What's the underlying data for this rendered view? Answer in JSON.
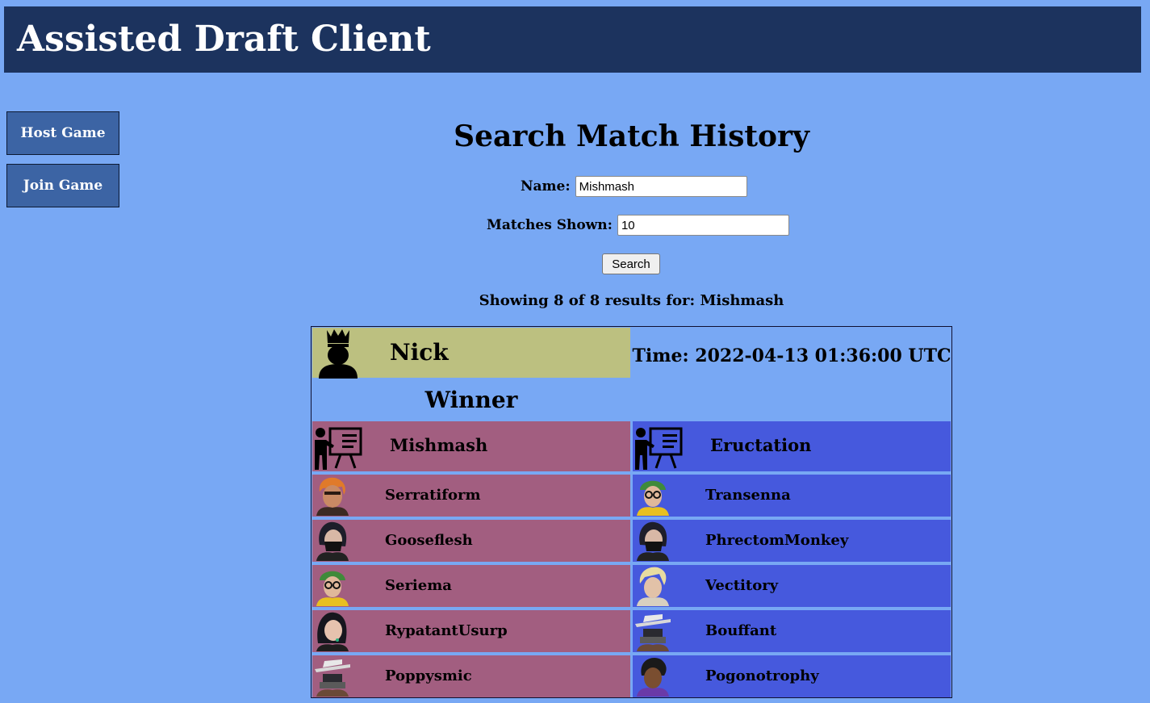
{
  "app": {
    "title": "Assisted Draft Client"
  },
  "sidebar": {
    "host_label": "Host Game",
    "join_label": "Join Game"
  },
  "search": {
    "title": "Search Match History",
    "name_label": "Name:",
    "name_value": "Mishmash",
    "matches_label": "Matches Shown:",
    "matches_value": "10",
    "button_label": "Search",
    "results_text": "Showing 8 of 8 results for: Mishmash"
  },
  "match": {
    "winner_name": "Nick",
    "winner_icon": "crowned-person-icon",
    "winner_label": "Winner",
    "time_text": "Time: 2022-04-13 01:36:00 UTC",
    "colors": {
      "winner_bg": "#bcc080",
      "team_red": "#a25e80",
      "team_blue": "#4659dd"
    },
    "team_left": {
      "captain": "Mishmash",
      "captain_icon": "coach-presentation-icon",
      "players": [
        {
          "name": "Serratiform",
          "avatar": "agent-avatar-orange-hair-icon"
        },
        {
          "name": "Gooseflesh",
          "avatar": "agent-avatar-masked-icon"
        },
        {
          "name": "Seriema",
          "avatar": "agent-avatar-green-beanie-icon"
        },
        {
          "name": "RypatantUsurp",
          "avatar": "agent-avatar-ponytail-icon"
        },
        {
          "name": "Poppysmic",
          "avatar": "agent-avatar-wide-hat-icon"
        }
      ]
    },
    "team_right": {
      "captain": "Eructation",
      "captain_icon": "coach-presentation-icon",
      "players": [
        {
          "name": "Transenna",
          "avatar": "agent-avatar-green-beanie-icon"
        },
        {
          "name": "PhrectomMonkey",
          "avatar": "agent-avatar-masked-icon"
        },
        {
          "name": "Vectitory",
          "avatar": "agent-avatar-blond-icon"
        },
        {
          "name": "Bouffant",
          "avatar": "agent-avatar-wide-hat-icon"
        },
        {
          "name": "Pogonotrophy",
          "avatar": "agent-avatar-dreadlocks-icon"
        }
      ]
    }
  }
}
